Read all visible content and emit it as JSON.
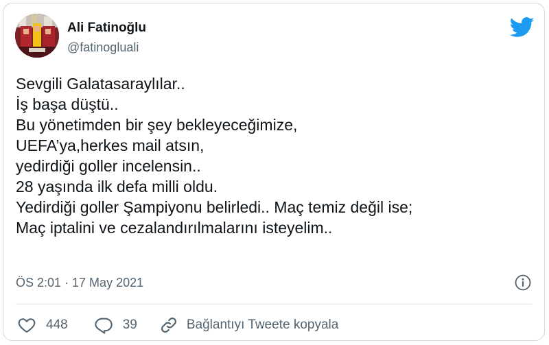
{
  "author": {
    "display_name": "Ali Fatinoğlu",
    "handle": "@fatinogluali"
  },
  "tweet": {
    "lines": [
      "Sevgili Galatasaraylılar..",
      "İş başa düştü..",
      "Bu yönetimden bir şey bekleyeceğimize,",
      "UEFA’ya,herkes mail atsın,",
      "yedirdiği goller incelensin..",
      "28 yaşında ilk defa milli oldu.",
      "Yedirdiği goller Şampiyonu belirledi.. Maç temiz değil ise;",
      "Maç iptalini ve cezalandırılmalarını isteyelim.."
    ],
    "timestamp": "ÖS 2:01 · 17 May 2021"
  },
  "actions": {
    "like_count": "448",
    "reply_count": "39",
    "copy_link_label": "Bağlantıyı Tweete kopyala"
  },
  "colors": {
    "twitter_blue": "#1d9bf0",
    "secondary_text": "#536471",
    "primary_text": "#0f1419",
    "border": "#cfd9de"
  },
  "icons": [
    "twitter-bird-icon",
    "info-icon",
    "heart-icon",
    "reply-icon",
    "link-icon"
  ]
}
